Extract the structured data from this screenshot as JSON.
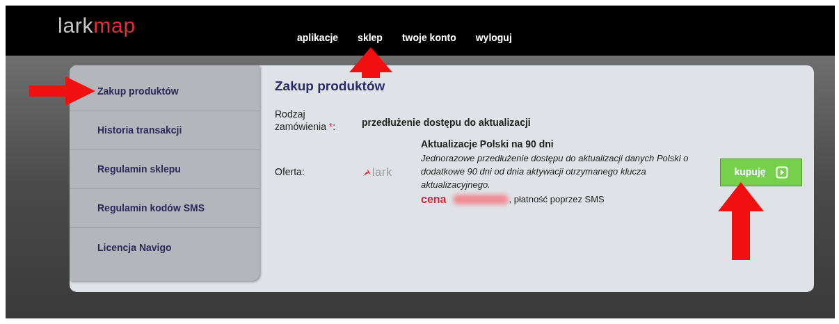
{
  "header": {
    "logo": {
      "part_1": "lark",
      "part_2": "map"
    },
    "nav": [
      {
        "label": "aplikacje"
      },
      {
        "label": "sklep"
      },
      {
        "label": "twoje konto"
      },
      {
        "label": "wyloguj"
      }
    ]
  },
  "sidebar": {
    "items": [
      {
        "label": "Zakup produktów"
      },
      {
        "label": "Historia transakcji"
      },
      {
        "label": "Regulamin sklepu"
      },
      {
        "label": "Regulamin kodów SMS"
      },
      {
        "label": "Licencja Navigo"
      }
    ]
  },
  "content": {
    "title": "Zakup produktów",
    "order_type": {
      "label": "Rodzaj zamówienia",
      "required_mark": "*",
      "suffix": ":",
      "value": "przedłużenie dostępu do aktualizacji"
    },
    "offer": {
      "label": "Oferta:",
      "logo_text": "lark",
      "name": "Aktualizacje Polski na 90 dni",
      "description": "Jednorazowe przedłużenie dostępu do aktualizacji danych Polski o dodatkowe 90 dni od dnia aktywacji otrzymanego klucza aktualizacyjnego.",
      "price_label": "cena",
      "payment": ", płatność poprzez SMS"
    },
    "buy_button": "kupuję"
  }
}
